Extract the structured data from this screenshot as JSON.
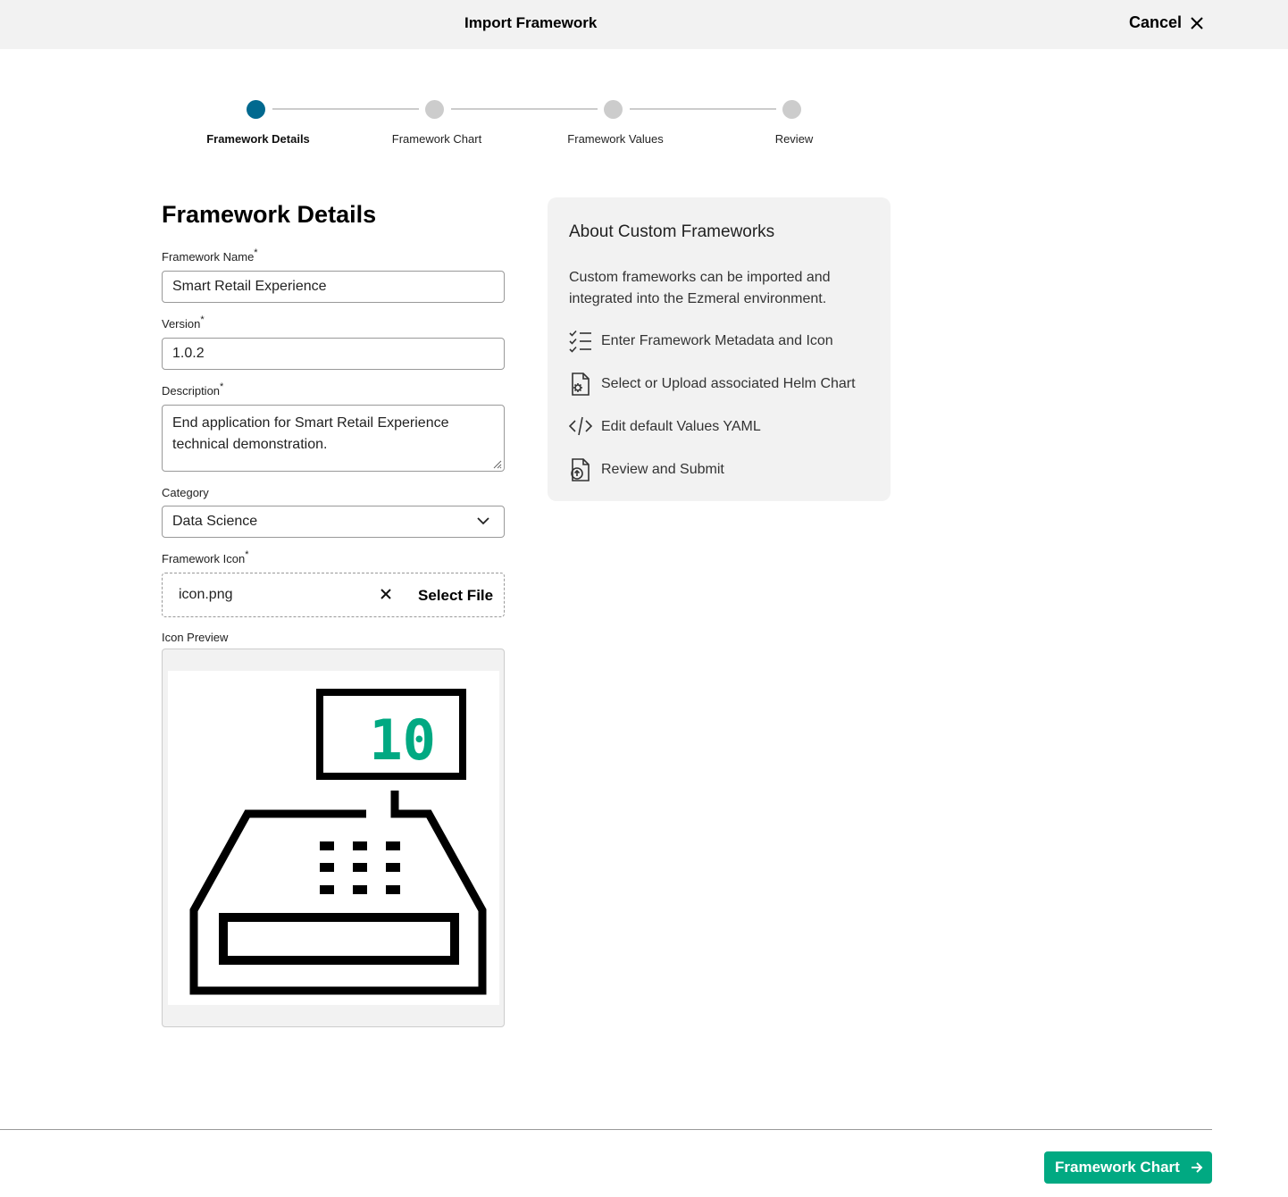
{
  "header": {
    "title": "Import Framework",
    "cancel_label": "Cancel"
  },
  "stepper": {
    "steps": [
      {
        "label": "Framework Details",
        "active": true
      },
      {
        "label": "Framework Chart",
        "active": false
      },
      {
        "label": "Framework Values",
        "active": false
      },
      {
        "label": "Review",
        "active": false
      }
    ]
  },
  "form": {
    "heading": "Framework Details",
    "name": {
      "label": "Framework Name",
      "required": "*",
      "value": "Smart Retail Experience"
    },
    "version": {
      "label": "Version",
      "required": "*",
      "value": "1.0.2"
    },
    "description": {
      "label": "Description",
      "required": "*",
      "value": "End application for Smart Retail Experience technical demonstration."
    },
    "category": {
      "label": "Category",
      "value": "Data Science"
    },
    "icon": {
      "label": "Framework Icon",
      "required": "*",
      "file_name": "icon.png",
      "select_label": "Select File"
    },
    "preview": {
      "label": "Icon Preview",
      "display_digits": "10"
    }
  },
  "info_panel": {
    "title": "About Custom Frameworks",
    "description": "Custom frameworks can be imported and integrated into the Ezmeral environment.",
    "items": [
      {
        "icon": "checklist-icon",
        "label": "Enter Framework Metadata and Icon"
      },
      {
        "icon": "document-config-icon",
        "label": "Select or Upload associated Helm Chart"
      },
      {
        "icon": "code-icon",
        "label": "Edit default Values YAML"
      },
      {
        "icon": "document-upload-icon",
        "label": "Review and Submit"
      }
    ]
  },
  "footer": {
    "next_label": "Framework Chart"
  },
  "colors": {
    "accent": "#01a982",
    "step_active": "#01698f",
    "step_inactive": "#cccccc"
  }
}
